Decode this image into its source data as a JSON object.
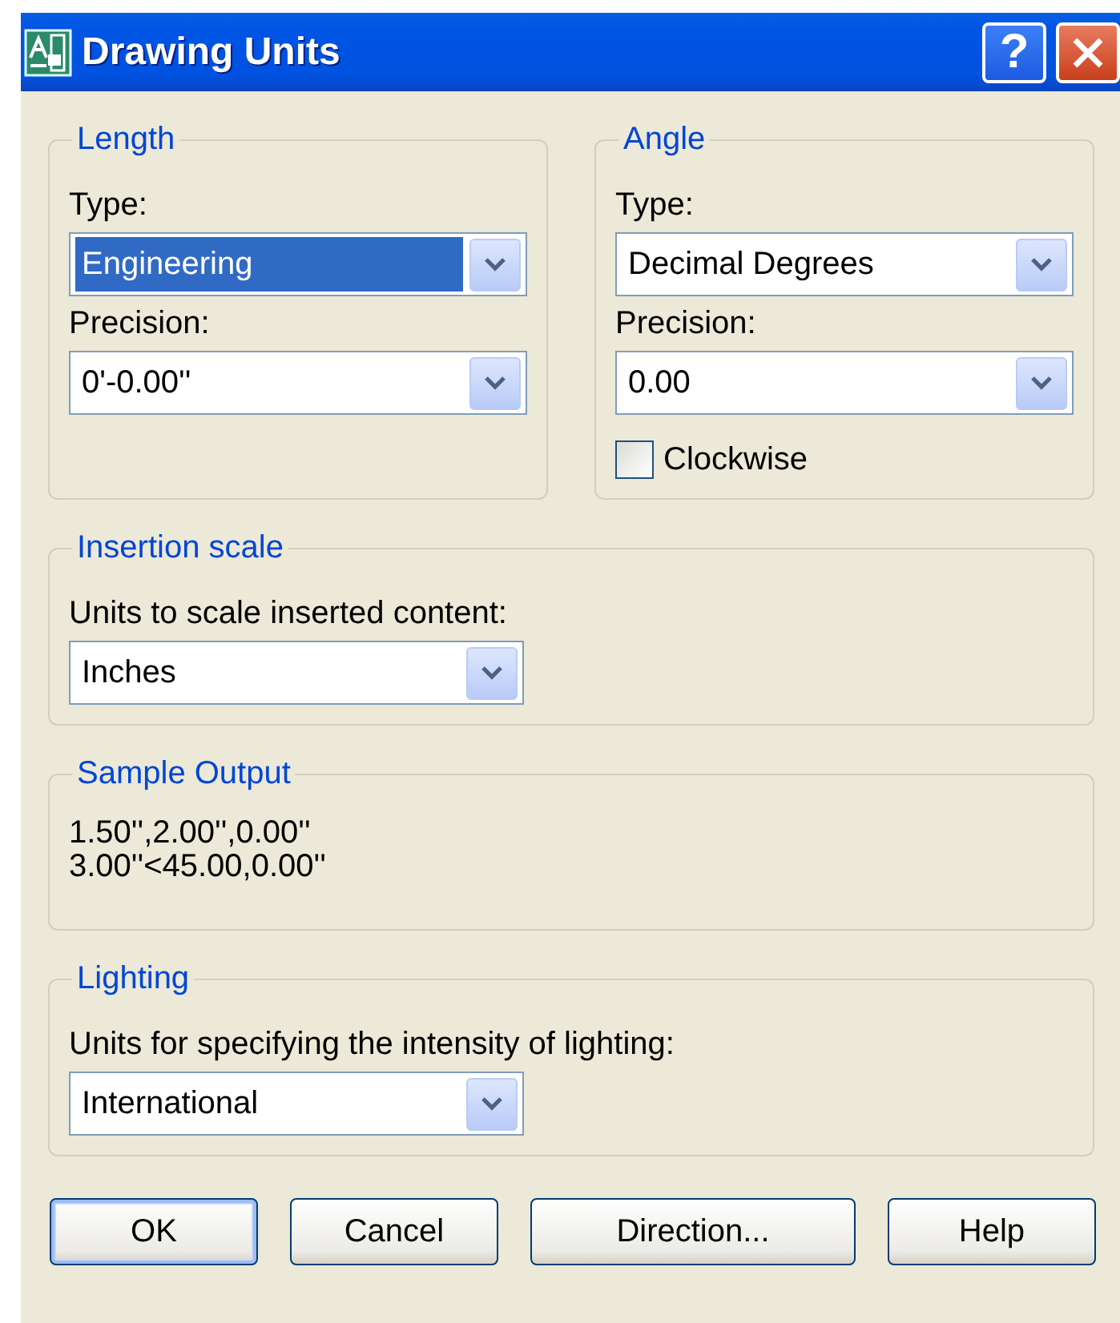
{
  "window": {
    "title": "Drawing Units",
    "help_glyph": "?"
  },
  "length": {
    "title": "Length",
    "type_label": "Type:",
    "type": {
      "value": "Engineering",
      "focused": true
    },
    "precision_label": "Precision:",
    "precision": {
      "value": "0'-0.00''",
      "focused": false
    }
  },
  "angle": {
    "title": "Angle",
    "type_label": "Type:",
    "type": {
      "value": "Decimal Degrees",
      "focused": false
    },
    "precision_label": "Precision:",
    "precision": {
      "value": "0.00",
      "focused": false
    },
    "clockwise": {
      "label": "Clockwise",
      "checked": false
    }
  },
  "insertion_scale": {
    "title": "Insertion scale",
    "label": "Units to scale inserted content:",
    "units": {
      "value": "Inches",
      "focused": false
    }
  },
  "sample_output": {
    "title": "Sample Output",
    "lines": [
      "1.50'',2.00'',0.00''",
      "3.00''<45.00,0.00''"
    ]
  },
  "lighting": {
    "title": "Lighting",
    "label": "Units for specifying the intensity of lighting:",
    "units": {
      "value": "International",
      "focused": false
    }
  },
  "buttons": [
    {
      "label": "OK",
      "default": true
    },
    {
      "label": "Cancel",
      "default": false
    },
    {
      "label": "Direction...",
      "default": false
    },
    {
      "label": "Help",
      "default": false
    }
  ]
}
